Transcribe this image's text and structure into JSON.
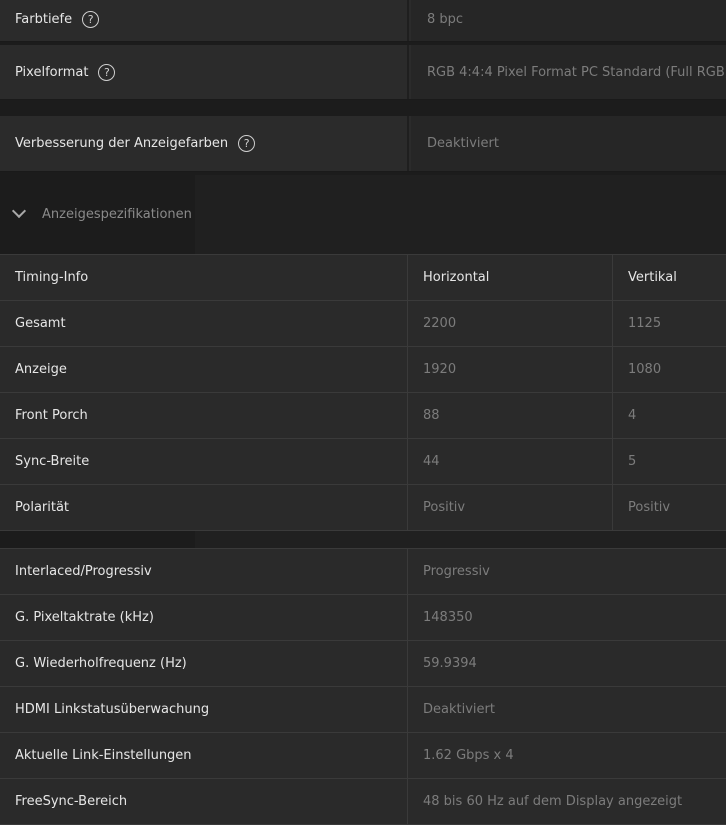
{
  "settings": [
    {
      "label": "Farbtiefe",
      "value": "8 bpc"
    },
    {
      "label": "Pixelformat",
      "value": "RGB 4:4:4 Pixel Format PC Standard (Full RGB)"
    },
    {
      "label": "Verbesserung der Anzeigefarben",
      "value": "Deaktiviert"
    }
  ],
  "help_glyph": "?",
  "section": {
    "title": "Anzeigespezifikationen",
    "icon": "chevron-down-icon",
    "expanded": true
  },
  "timing_table": {
    "headers": [
      "Timing-Info",
      "Horizontal",
      "Vertikal"
    ],
    "rows": [
      [
        "Gesamt",
        "2200",
        "1125"
      ],
      [
        "Anzeige",
        "1920",
        "1080"
      ],
      [
        "Front Porch",
        "88",
        "4"
      ],
      [
        "Sync-Breite",
        "44",
        "5"
      ],
      [
        "Polarität",
        "Positiv",
        "Positiv"
      ]
    ]
  },
  "info_table": {
    "rows": [
      [
        "Interlaced/Progressiv",
        "Progressiv"
      ],
      [
        "G. Pixeltaktrate (kHz)",
        "148350"
      ],
      [
        "G. Wiederholfrequenz (Hz)",
        "59.9394"
      ],
      [
        "HDMI Linkstatusüberwachung",
        "Deaktiviert"
      ],
      [
        "Aktuelle Link-Einstellungen",
        "1.62 Gbps x 4"
      ],
      [
        "FreeSync-Bereich",
        "48 bis 60 Hz auf dem Display angezeigt"
      ]
    ]
  },
  "colors": {
    "background": "#1c1c1c",
    "row": "#2a2a2a",
    "text": "#e6e6e6",
    "muted": "#7c7c7c"
  }
}
